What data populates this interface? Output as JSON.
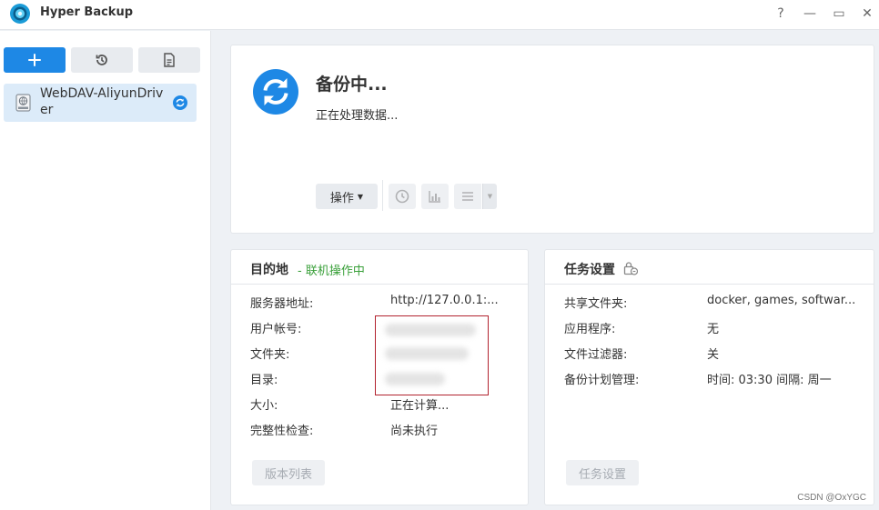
{
  "window": {
    "title": "Hyper Backup",
    "controls": {
      "help": "?",
      "minimize": "—",
      "maximize": "▭",
      "close": "✕"
    }
  },
  "sidebar": {
    "toolbar": {
      "add_icon": "plus-icon",
      "history_icon": "restore-icon",
      "log_icon": "document-icon"
    },
    "tasks": [
      {
        "name": "WebDAV-AliyunDriver",
        "icon": "network-drive-icon",
        "status_icon": "sync-icon"
      }
    ]
  },
  "status": {
    "title": "备份中...",
    "subtitle": "正在处理数据...",
    "action_label": "操作",
    "icon_buttons": [
      "clock-icon",
      "bar-chart-icon",
      "list-icon"
    ],
    "accent_color": "#1e88e5"
  },
  "destination": {
    "title": "目的地",
    "status": "- 联机操作中",
    "status_color": "#3aa03a",
    "rows": [
      {
        "label": "服务器地址:",
        "value": "http://127.0.0.1:..."
      },
      {
        "label": "用户帐号:",
        "value": ""
      },
      {
        "label": "文件夹:",
        "value": ""
      },
      {
        "label": "目录:",
        "value": ""
      },
      {
        "label": "大小:",
        "value": "正在计算..."
      },
      {
        "label": "完整性检查:",
        "value": "尚未执行"
      }
    ],
    "button": "版本列表"
  },
  "task_settings": {
    "title": "任务设置",
    "rows": [
      {
        "label": "共享文件夹:",
        "value": "docker, games, softwar..."
      },
      {
        "label": "应用程序:",
        "value": "无"
      },
      {
        "label": "文件过滤器:",
        "value": "关"
      },
      {
        "label": "备份计划管理:",
        "value": "时间: 03:30 间隔: 周一"
      }
    ],
    "button": "任务设置"
  },
  "watermark": "CSDN @OxYGC"
}
